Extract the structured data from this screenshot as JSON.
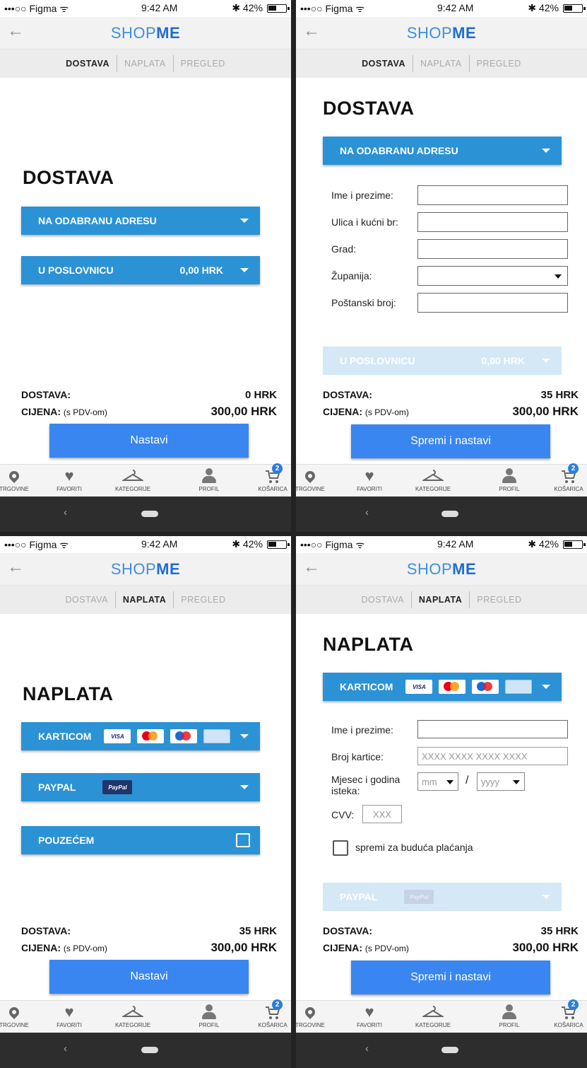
{
  "status": {
    "carrier": "•••○○ Figma",
    "wifi": "ᯤ",
    "time": "9:42 AM",
    "battery": "✱ 42%"
  },
  "header": {
    "back": "←",
    "logo_a": "SHOP",
    "logo_b": "ME"
  },
  "steps": [
    "DOSTAVA",
    "NAPLATA",
    "PREGLED"
  ],
  "tabs": [
    {
      "label": "TRGOVINE",
      "icon": "location-pin-icon"
    },
    {
      "label": "FAVORITI",
      "icon": "heart-icon"
    },
    {
      "label": "KATEGORIJE",
      "icon": "hanger-icon"
    },
    {
      "label": "PROFIL",
      "icon": "person-icon"
    },
    {
      "label": "KOŠARICA",
      "icon": "cart-icon",
      "badge": "2"
    }
  ],
  "android_nav": {
    "back": "‹"
  },
  "screen1": {
    "title": "DOSTAVA",
    "option1": "NA ODABRANU ADRESU",
    "option2": "U POSLOVNICU",
    "option2_price": "0,00 HRK",
    "dostava_label": "DOSTAVA:",
    "dostava_value": "0 HRK",
    "cijena_label": "CIJENA:",
    "cijena_note": "(s PDV-om)",
    "cijena_value": "300,00 HRK",
    "button": "Nastavi"
  },
  "screen2": {
    "title": "DOSTAVA",
    "option1": "NA ODABRANU ADRESU",
    "fields": [
      "Ime i prezime:",
      "Ulica i kućni br:",
      "Grad:",
      "Županija:",
      "Poštanski broj:"
    ],
    "option2": "U POSLOVNICU",
    "option2_price": "0,00 HRK",
    "dostava_label": "DOSTAVA:",
    "dostava_value": "35 HRK",
    "cijena_label": "CIJENA:",
    "cijena_note": "(s PDV-om)",
    "cijena_value": "300,00 HRK",
    "button": "Spremi i nastavi"
  },
  "screen3": {
    "title": "NAPLATA",
    "option1": "KARTICOM",
    "option2": "PAYPAL",
    "option3": "POUZEĆEM",
    "dostava_label": "DOSTAVA:",
    "dostava_value": "35 HRK",
    "cijena_label": "CIJENA:",
    "cijena_note": "(s PDV-om)",
    "cijena_value": "300,00 HRK",
    "button": "Nastavi"
  },
  "screen4": {
    "title": "NAPLATA",
    "option1": "KARTICOM",
    "name_label": "Ime i prezime:",
    "card_label": "Broj kartice:",
    "card_placeholder": "XXXX XXXX XXXX XXXX",
    "expiry_label_1": "Mjesec i godina",
    "expiry_label_2": "isteka:",
    "month_placeholder": "mm",
    "year_placeholder": "yyyy",
    "slash": "/",
    "cvv_label": "CVV:",
    "cvv_placeholder": "XXX",
    "save_label": "spremi za buduća plaćanja",
    "option2": "PAYPAL",
    "dostava_label": "DOSTAVA:",
    "dostava_value": "35 HRK",
    "cijena_label": "CIJENA:",
    "cijena_note": "(s PDV-om)",
    "cijena_value": "300,00 HRK",
    "button": "Spremi i nastavi"
  },
  "card_brands": {
    "visa": "VISA",
    "amex": "AMERICAN EXPRESS",
    "paypal": "PayPal"
  }
}
